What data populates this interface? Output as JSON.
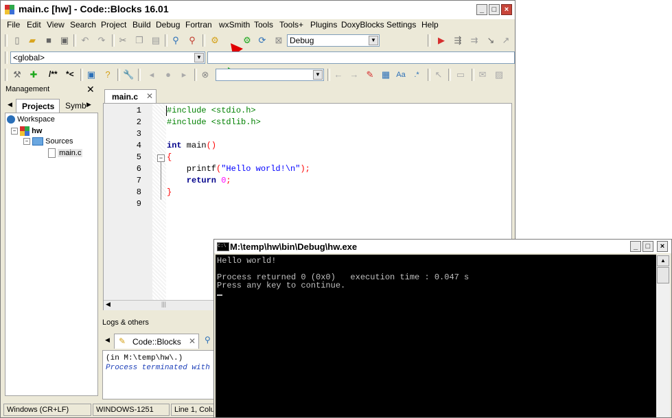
{
  "cb": {
    "title": "main.c [hw] - Code::Blocks 16.01",
    "menu": [
      "File",
      "Edit",
      "View",
      "Search",
      "Project",
      "Build",
      "Debug",
      "Fortran",
      "wxSmith",
      "Tools",
      "Tools+",
      "Plugins",
      "DoxyBlocks",
      "Settings",
      "Help"
    ],
    "build_target": "Debug",
    "scope": "<global>",
    "doxy_labels": [
      "/**",
      "*<"
    ]
  },
  "management": {
    "title": "Management",
    "tabs": [
      "Projects",
      "Symb"
    ],
    "tree": {
      "workspace": "Workspace",
      "project": "hw",
      "folder": "Sources",
      "file": "main.c"
    }
  },
  "editor": {
    "tab": "main.c",
    "line_numbers": [
      "1",
      "2",
      "3",
      "4",
      "5",
      "6",
      "7",
      "8",
      "9"
    ],
    "lines": {
      "l1": "#include <stdio.h>",
      "l2": "#include <stdlib.h>",
      "l4_kw": "int",
      "l4_rest": " main",
      "l4_par": "()",
      "l5": "{",
      "l6_fn": "    printf",
      "l6_p1": "(",
      "l6_str": "\"Hello world!\\n\"",
      "l6_p2": ");",
      "l7_kw": "    return",
      "l7_num": " 0",
      "l7_semi": ";",
      "l8": "}"
    }
  },
  "logs": {
    "title": "Logs & others",
    "tab": "Code::Blocks",
    "line1": "(in M:\\temp\\hw\\.)",
    "line2": "Process terminated with"
  },
  "status": {
    "eol": "Windows (CR+LF)",
    "encoding": "WINDOWS-1251",
    "position": "Line 1, Colu"
  },
  "console": {
    "title": "M:\\temp\\hw\\bin\\Debug\\hw.exe",
    "line1": "Hello world!",
    "line2": "Process returned 0 (0x0)   execution time : 0.047 s",
    "line3": "Press any key to continue."
  },
  "colors": {
    "run_arrow": "#1ea81e",
    "pointer_arrow": "#e00000",
    "console_bg": "#000000",
    "console_text": "#c0c0c0"
  }
}
